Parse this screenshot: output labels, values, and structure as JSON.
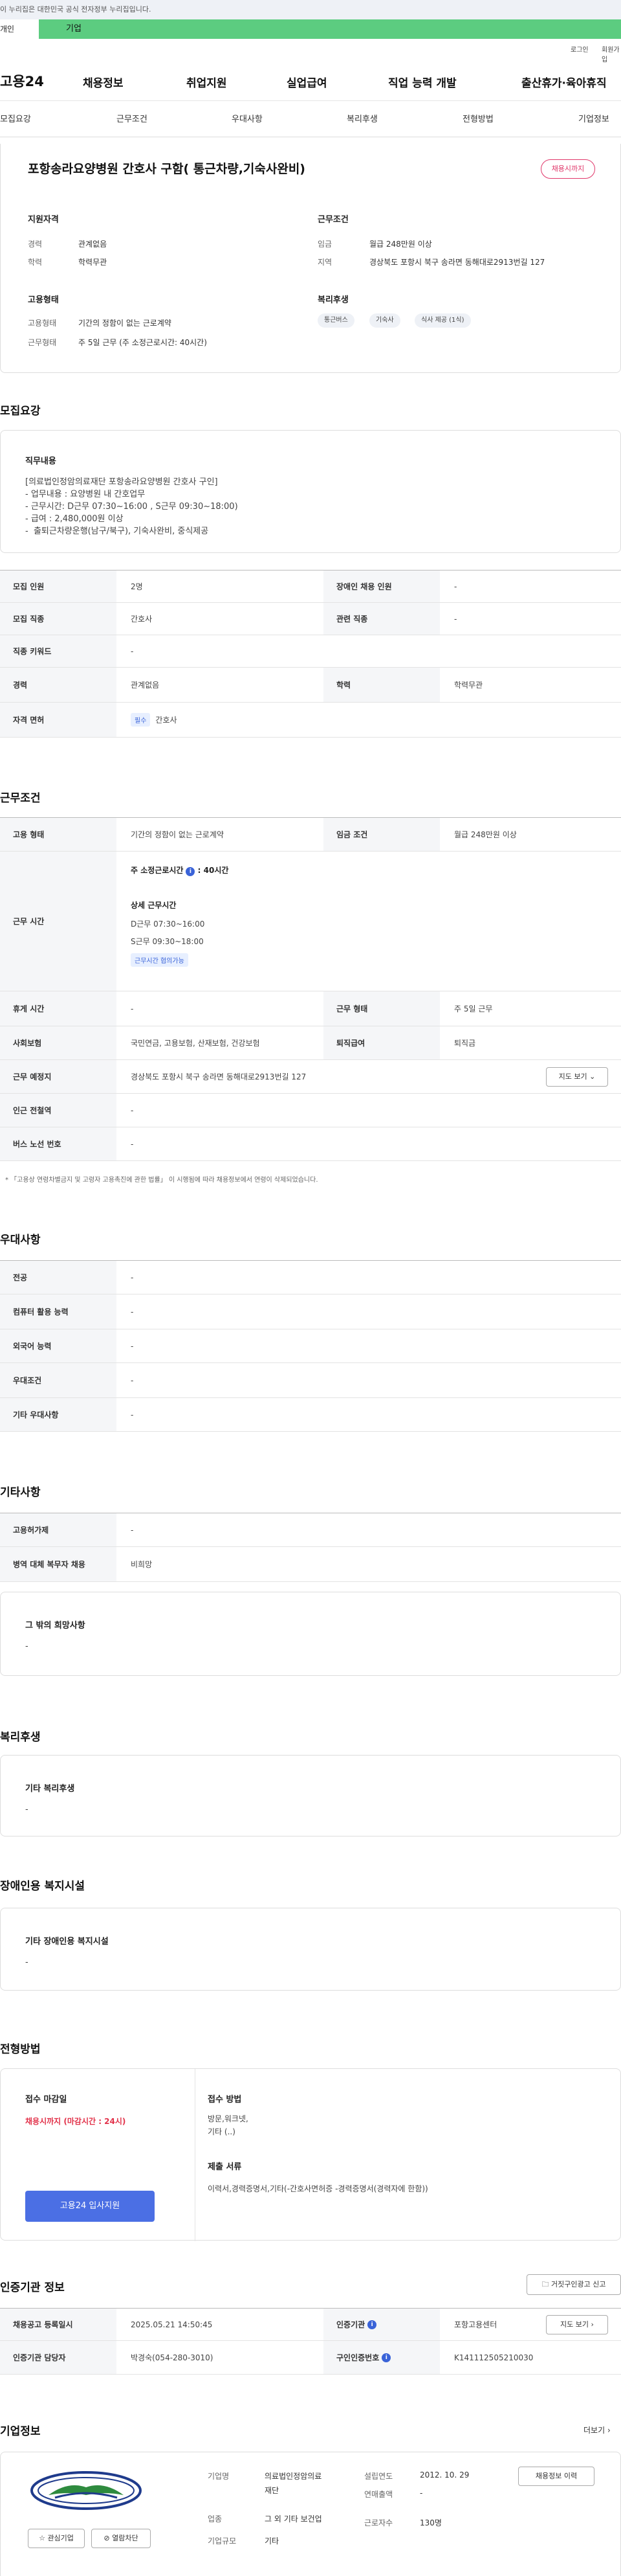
{
  "gov_banner": "이 누리집은 대한민국 공식 전자정부 누리집입니다.",
  "gnb_top": {
    "tab_person": "개인",
    "tab_company": "기업"
  },
  "util": {
    "login": "로그인",
    "join": "회원가입"
  },
  "gnb": {
    "logo": "고용24",
    "menus": [
      "채용정보",
      "취업지원",
      "실업급여",
      "직업 능력 개발",
      "출산휴가·육아휴직"
    ]
  },
  "subnav": [
    "모집요강",
    "근무조건",
    "우대사항",
    "복리후생",
    "전형방법",
    "기업정보"
  ],
  "summary": {
    "title": "포항송라요양병원 간호사 구함( 통근차량,기숙사완비)",
    "badge": "채용시까지",
    "qual_h": "지원자격",
    "cond_h": "근무조건",
    "emp_h": "고용형태",
    "welfare_h": "복리후생",
    "career_k": "경력",
    "career_v": "관계없음",
    "edu_k": "학력",
    "edu_v": "학력무관",
    "wage_k": "임금",
    "wage_v": "월급 248만원 이상",
    "region_k": "지역",
    "region_v": "경상북도 포항시 북구 송라면 동해대로2913번길 127",
    "emptype_k": "고용형태",
    "emptype_v": "기간의 정함이 없는 근로계약",
    "workshape_k": "근무형태",
    "workshape_v": "주 5일 근무 (주 소정근로시간: 40시간)",
    "chips": [
      "통근버스",
      "기숙사",
      "식사 제공 (1식)"
    ]
  },
  "recruit": {
    "title": "모집요강",
    "duty_h": "직무내용",
    "duty_text": "[의료법인정암의료재단 포항송라요양병원 간호사 구인]\n- 업무내용 : 요양병원 내 간호업무\n- 근무시간: D근무 07:30~16:00 , S근무 09:30~18:00)\n- 급여 : 2,480,000원 이상\n-  출퇴근차량운행(남구/북구), 기숙사완비, 중식제공",
    "rows": [
      {
        "k1": "모집 인원",
        "v1": "2명",
        "k2": "장애인 채용 인원",
        "v2": "-"
      },
      {
        "k1": "모집 직종",
        "v1": "간호사",
        "k2": "관련 직종",
        "v2": "-"
      },
      {
        "k1": "직종 키워드",
        "v1": "-"
      },
      {
        "k1": "경력",
        "v1": "관계없음",
        "k2": "학력",
        "v2": "학력무관"
      },
      {
        "k1": "자격 면허",
        "tag": "필수",
        "v1": "간호사"
      }
    ]
  },
  "work": {
    "title": "근무조건",
    "emp_k": "고용 형태",
    "emp_v": "기간의 정함이 없는 근로계약",
    "wage_k": "임금 조건",
    "wage_v": "월급 248만원 이상",
    "hours_k": "근무 시간",
    "hours_weekly": "주 소정근로시간",
    "hours_weekly_v": ": 40시간",
    "hours_detail_h": "상세 근무시간",
    "hours_d": "D근무 07:30~16:00",
    "hours_s": "S근무 09:30~18:00",
    "hours_tag": "근무시간 협의가능",
    "rest_k": "휴게 시간",
    "rest_v": "-",
    "shape_k": "근무 형태",
    "shape_v": "주 5일 근무",
    "ins_k": "사회보험",
    "ins_v": "국민연금, 고용보험, 산재보험, 건강보험",
    "retire_k": "퇴직급여",
    "retire_v": "퇴직금",
    "place_k": "근무 예정지",
    "place_v": "경상북도 포항시 북구 송라면 동해대로2913번길 127",
    "map_btn": "지도 보기",
    "station_k": "인근 전철역",
    "station_v": "-",
    "bus_k": "버스 노선 번호",
    "bus_v": "-",
    "note": "* 「고용상 연령차별금지 및 고령자 고용촉진에 관한 법률」 이 시행됨에 따라 채용정보에서 연령이 삭제되었습니다."
  },
  "pref": {
    "title": "우대사항",
    "rows": [
      [
        "전공",
        "-"
      ],
      [
        "컴퓨터 활용 능력",
        "-"
      ],
      [
        "외국어 능력",
        "-"
      ],
      [
        "우대조건",
        "-"
      ],
      [
        "기타 우대사항",
        "-"
      ]
    ]
  },
  "etc": {
    "title": "기타사항",
    "rows": [
      [
        "고용허가제",
        "-"
      ],
      [
        "병역 대체 복무자 채용",
        "비희망"
      ]
    ],
    "card_h": "그 밖의 희망사항",
    "card_v": "-"
  },
  "welfare": {
    "title": "복리후생",
    "card_h": "기타 복리후생",
    "card_v": "-"
  },
  "disab": {
    "title": "장애인용 복지시설",
    "card_h": "기타 장애인용 복지시설",
    "card_v": "-"
  },
  "process": {
    "title": "전형방법",
    "deadline_h": "접수 마감일",
    "deadline_v": "채용시까지 (마감시간 : 24시)",
    "apply_btn": "고용24 입사지원",
    "method_h": "접수 방법",
    "method_v1": "방문,워크넷,",
    "method_v2": "기타 (..)",
    "docs_h": "제출 서류",
    "docs_v": "이력서,경력증명서,기타(-간호사면허증 -경력증명서(경력자에 한함))"
  },
  "cert": {
    "title": "인증기관 정보",
    "report_btn": "거짓구인광고 신고",
    "reg_k": "채용공고 등록일시",
    "reg_v": "2025.05.21 14:50:45",
    "org_k": "인증기관",
    "org_v": "포항고용센터",
    "map_btn": "지도 보기",
    "mgr_k": "인증기관 담당자",
    "mgr_v": "박경숙(054-280-3010)",
    "num_k": "구인인증번호",
    "num_v": "K141112505210030"
  },
  "company": {
    "title": "기업정보",
    "more": "더보기",
    "name_k": "기업명",
    "name_v1": "의료법인정암의료",
    "name_v2": "재단",
    "year_k": "설립연도",
    "year_v": "2012. 10. 29",
    "ind_k": "업종",
    "ind_v1": "그 외 기타 보건업",
    "ind_v2": "",
    "sales_k": "연매출액",
    "sales_v": "-",
    "size_k": "기업규모",
    "size_v": "기타",
    "emp_k": "근로자수",
    "emp_v": "130명",
    "history_btn": "채용정보 이력",
    "fav_btn": "관심기업",
    "block_btn": "열람차단"
  }
}
